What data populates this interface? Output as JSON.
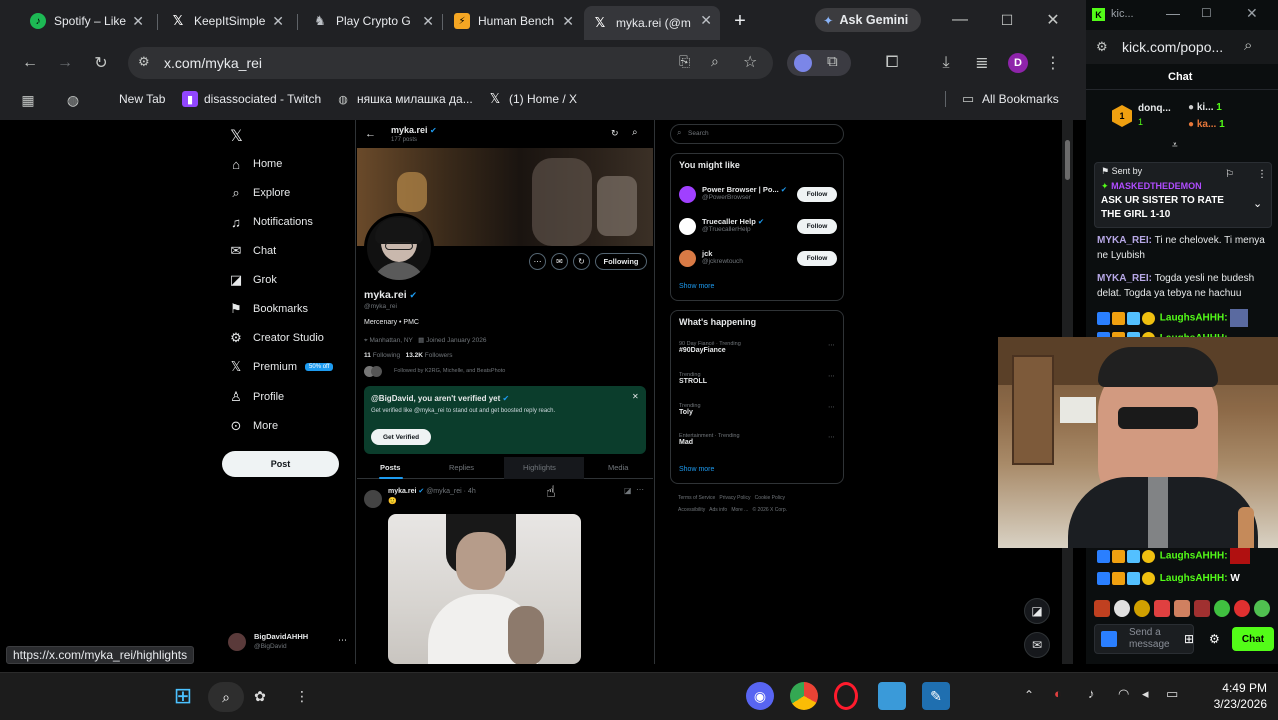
{
  "browser": {
    "tabs": [
      {
        "label": "Spotify – Like",
        "icon": "spotify-icon",
        "color": "#1db954",
        "glyph": "●"
      },
      {
        "label": "KeepItSimple",
        "icon": "x-logo-icon",
        "color": "#ffffff",
        "glyph": "𝕏"
      },
      {
        "label": "Play Crypto G",
        "icon": "game-icon",
        "color": "#9aa0a6",
        "glyph": "♞"
      },
      {
        "label": "Human Bench",
        "icon": "lightning-icon",
        "color": "#f5a623",
        "glyph": "⚡"
      },
      {
        "label": "myka.rei (@m",
        "icon": "x-logo-icon",
        "color": "#ffffff",
        "glyph": "𝕏"
      }
    ],
    "new_tab": "+",
    "gemini_label": "Ask Gemini",
    "url": "x.com/myka_rei",
    "profile_initial": "D",
    "bookmarks": [
      {
        "label": "New Tab",
        "icon": "globe-icon"
      },
      {
        "label": "disassociated - Twitch",
        "icon": "twitch-icon"
      },
      {
        "label": "няшка милашка да...",
        "icon": "globe-icon"
      },
      {
        "label": "(1) Home / X",
        "icon": "x-logo-icon"
      }
    ],
    "all_bookmarks": "All Bookmarks",
    "status_url": "https://x.com/myka_rei/highlights"
  },
  "x_nav": {
    "items": [
      {
        "label": "Home",
        "glyph": "⌂"
      },
      {
        "label": "Explore",
        "glyph": "⌕"
      },
      {
        "label": "Notifications",
        "glyph": "🔔︎"
      },
      {
        "label": "Chat",
        "glyph": "✉"
      },
      {
        "label": "Grok",
        "glyph": "◪"
      },
      {
        "label": "Bookmarks",
        "glyph": "⚑"
      },
      {
        "label": "Creator Studio",
        "glyph": "⚙"
      },
      {
        "label": "Premium",
        "glyph": "𝕏"
      },
      {
        "label": "Profile",
        "glyph": "♙"
      },
      {
        "label": "More",
        "glyph": "⋯"
      }
    ],
    "premium_badge": "50% off",
    "post_button": "Post",
    "account_name": "BigDavidAHHH",
    "account_handle": "@BigDavid"
  },
  "profile": {
    "header_name": "myka.rei",
    "header_posts": "177 posts",
    "name": "myka.rei",
    "handle": "@myka_rei",
    "bio": "Mercenary • PMC",
    "location": "Manhattan, NY",
    "joined": "Joined January 2026",
    "following_count": "11",
    "following_label": "Following",
    "followers_count": "13.2K",
    "followers_label": "Followers",
    "followed_by": "Followed by K2RG, Michelle, and BeatsPhoto",
    "following_button": "Following",
    "verify_title": "@BigDavid, you aren't verified yet",
    "verify_text": "Get verified like @myka_rei to stand out and get boosted reply reach.",
    "verify_button": "Get Verified",
    "tabs": [
      "Posts",
      "Replies",
      "Highlights",
      "Media"
    ],
    "post_name": "myka.rei",
    "post_meta": "@myka_rei · 4h",
    "post_emoji": "🙂"
  },
  "sidebar": {
    "search_placeholder": "Search",
    "might_like_title": "You might like",
    "suggestions": [
      {
        "name": "Power Browser | Po...",
        "handle": "@PowerBrowser",
        "button": "Follow",
        "color": "#a040ff"
      },
      {
        "name": "Truecaller Help",
        "handle": "@TruecallerHelp",
        "button": "Follow",
        "color": "#ffffff"
      },
      {
        "name": "jck",
        "handle": "@jckrewtouch",
        "button": "Follow",
        "color": "#d97a45"
      }
    ],
    "show_more_1": "Show more",
    "happening_title": "What's happening",
    "trends": [
      {
        "context": "90 Day Fiancé · Trending",
        "topic": "#90DayFiance"
      },
      {
        "context": "Trending",
        "topic": "STROLL"
      },
      {
        "context": "Trending",
        "topic": "Toly"
      },
      {
        "context": "Entertainment · Trending",
        "topic": "Mad"
      }
    ],
    "show_more_2": "Show more",
    "footer_1": "Terms of Service   Privacy Policy   Cookie Policy",
    "footer_2": "Accessibility   Ads info   More ...   © 2026 X Corp."
  },
  "kick": {
    "url": "kick.com/popo...",
    "chat_title": "Chat",
    "top_gifters": [
      {
        "name": "donq...",
        "count": "1"
      },
      {
        "name": "ki...",
        "count": "1"
      },
      {
        "name": "ka...",
        "count": "1"
      }
    ],
    "pinned_label": "Sent by",
    "pinned_user": "MASKEDTHEDEMON",
    "pinned_message": "ASK UR SISTER TO RATE THE GIRL 1-10",
    "messages": [
      {
        "user": "MYKA_REI:",
        "text": "Ti ne chelovek. Ti menya ne Lyubish"
      },
      {
        "user": "MYKA_REI:",
        "text": "Togda yesli ne budesh delat. Togda ya tebya ne hachuu"
      },
      {
        "user": "LaughsAHHH:",
        "text": ""
      },
      {
        "user": "LaughsAHHH:",
        "text": ""
      },
      {
        "user": "LaughsAHHH:",
        "text": ""
      },
      {
        "user": "LaughsAHHH:",
        "text": ""
      }
    ],
    "send_placeholder": "Send a message",
    "chat_button": "Chat",
    "accent": "#53fc18"
  },
  "taskbar": {
    "time": "4:49 PM",
    "date": "3/23/2026"
  }
}
